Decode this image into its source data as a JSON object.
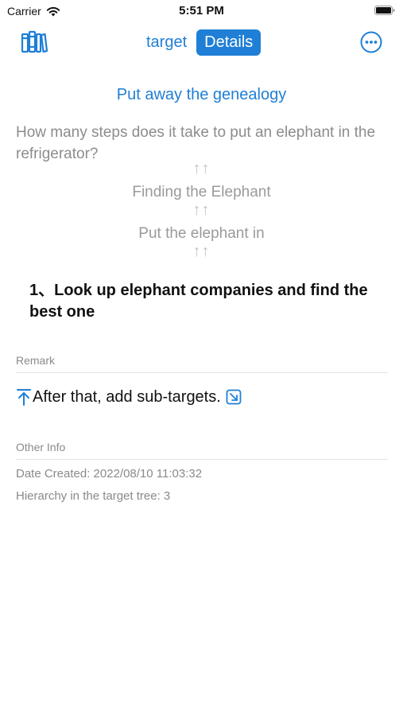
{
  "status_bar": {
    "carrier": "Carrier",
    "time": "5:51 PM"
  },
  "navbar": {
    "segments": [
      {
        "label": "target",
        "active": false
      },
      {
        "label": "Details",
        "active": true
      }
    ],
    "left_icon": "library-icon",
    "right_icon": "more-icon"
  },
  "main": {
    "genealogy_link": "Put away the genealogy",
    "question": "How many steps does it take to put an elephant in the refrigerator?",
    "chain_arrow": "↑↑",
    "chain": [
      "Finding the Elephant",
      "Put the elephant in"
    ],
    "target_title": "1、Look up elephant companies and find the best one"
  },
  "remark": {
    "label": "Remark",
    "text": "After that, add sub-targets."
  },
  "other_info": {
    "label": "Other Info",
    "date_created": "Date Created: 2022/08/10 11:03:32",
    "hierarchy": "Hierarchy in the target tree: 3"
  },
  "colors": {
    "accent": "#1f7fd6",
    "muted": "#8a8a8a"
  }
}
